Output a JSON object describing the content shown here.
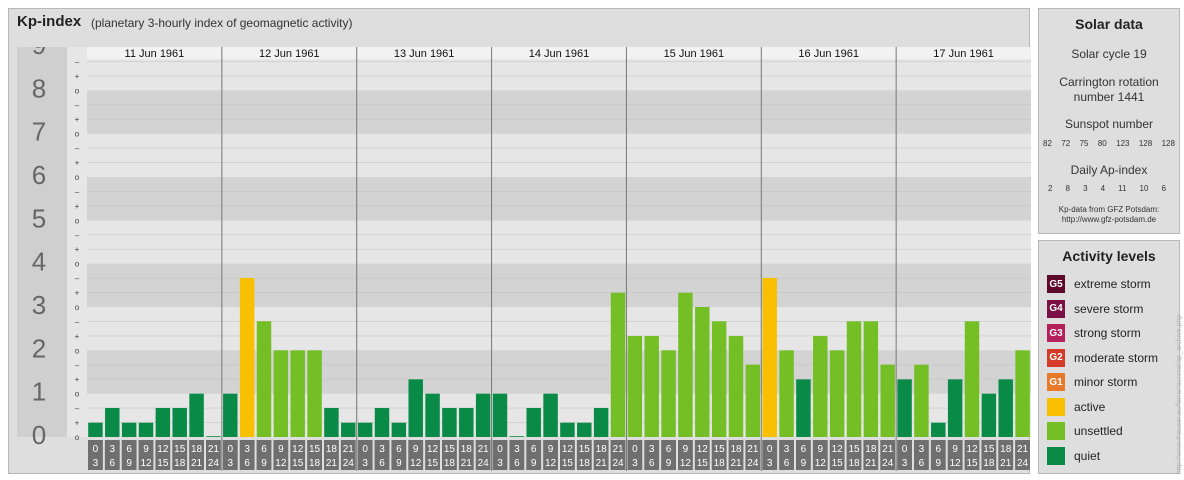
{
  "header": {
    "title": "Kp-index",
    "subtitle": "(planetary 3-hourly index of geomagnetic activity)"
  },
  "chart_data": {
    "type": "bar",
    "ylim": [
      0,
      9
    ],
    "y_major_ticks": [
      "0",
      "1",
      "2",
      "3",
      "4",
      "5",
      "6",
      "7",
      "8",
      "9"
    ],
    "y_minor_ticks": [
      "o",
      "+",
      "–"
    ],
    "days": [
      "11 Jun 1961",
      "12 Jun 1961",
      "13 Jun 1961",
      "14 Jun 1961",
      "15 Jun 1961",
      "16 Jun 1961",
      "17 Jun 1961"
    ],
    "interval_start_labels": [
      "0",
      "3",
      "6",
      "9",
      "12",
      "15",
      "18",
      "21"
    ],
    "interval_end_labels": [
      "3",
      "6",
      "9",
      "12",
      "15",
      "18",
      "21",
      "24"
    ],
    "values": [
      0.33,
      0.67,
      0.33,
      0.33,
      0.67,
      0.67,
      1.0,
      0.0,
      1.0,
      3.67,
      2.67,
      2.0,
      2.0,
      2.0,
      0.67,
      0.33,
      0.33,
      0.67,
      0.33,
      1.33,
      1.0,
      0.67,
      0.67,
      1.0,
      1.0,
      0.0,
      0.67,
      1.0,
      0.33,
      0.33,
      0.67,
      3.33,
      2.33,
      2.33,
      2.0,
      3.33,
      3.0,
      2.67,
      2.33,
      1.67,
      3.67,
      2.0,
      1.33,
      2.33,
      2.0,
      2.67,
      2.67,
      1.67,
      1.33,
      1.67,
      0.33,
      1.33,
      2.67,
      1.0,
      1.33,
      2.0
    ],
    "colors": {
      "quiet": "#0a8a47",
      "unsettled": "#74bf26",
      "active": "#f8c000",
      "day_band_light": "#e6e6e6",
      "day_band_dark": "#d3d3d3",
      "axis_column": "#cfcfcf",
      "axis_text": "#666666",
      "time_box": "#6f6f6f"
    }
  },
  "solar": {
    "title": "Solar data",
    "cycle": "Solar cycle 19",
    "carrington_1": "Carrington rotation",
    "carrington_2": "number 1441",
    "sunspot_label": "Sunspot number",
    "sunspot": [
      "82",
      "72",
      "75",
      "80",
      "123",
      "128",
      "128"
    ],
    "ap_label": "Daily Ap-index",
    "ap": [
      "2",
      "8",
      "3",
      "4",
      "11",
      "10",
      "6"
    ],
    "source_1": "Kp-data from GFZ Potsdam:",
    "source_2": "http://www.gfz-potsdam.de"
  },
  "levels": {
    "title": "Activity levels",
    "items": [
      {
        "code": "G5",
        "label": "extreme storm",
        "color": "#5e0a2a"
      },
      {
        "code": "G4",
        "label": "severe storm",
        "color": "#7a1045"
      },
      {
        "code": "G3",
        "label": "strong storm",
        "color": "#b51f5c"
      },
      {
        "code": "G2",
        "label": "moderate storm",
        "color": "#d63b27"
      },
      {
        "code": "G1",
        "label": "minor storm",
        "color": "#e8782a"
      },
      {
        "code": "",
        "label": "active",
        "color": "#f8c000"
      },
      {
        "code": "",
        "label": "unsettled",
        "color": "#74bf26"
      },
      {
        "code": "",
        "label": "quiet",
        "color": "#0a8a47"
      }
    ]
  },
  "watermark": "http://www.theuser.eu/ferrar/auroral/ap_archive.php"
}
